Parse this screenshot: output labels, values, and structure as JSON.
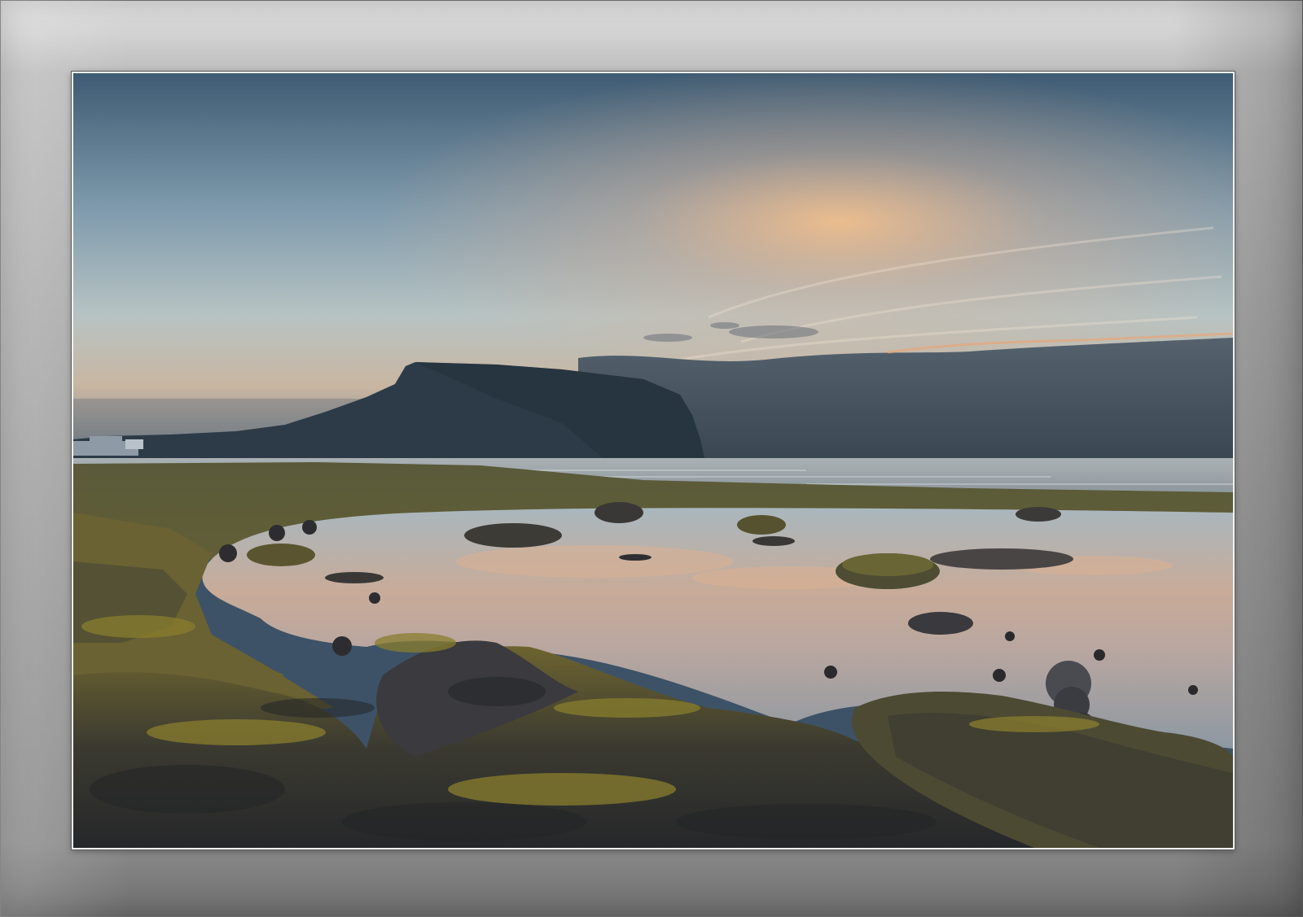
{
  "image": {
    "subject": "sunset-seascape",
    "colors": {
      "frame_light": "#e4e4e4",
      "frame_dark": "#6f6f6f",
      "sky_top": "#3f5b73",
      "sky_mid": "#9fb3bd",
      "sky_glow": "#f0b585",
      "cloud_bank": "#3b4a59",
      "headland": "#2b3a46",
      "sea": "#9aa6ad",
      "tide_pool": "#b9a59a",
      "moss": "#8a7d2e",
      "rock": "#2f3034"
    }
  }
}
